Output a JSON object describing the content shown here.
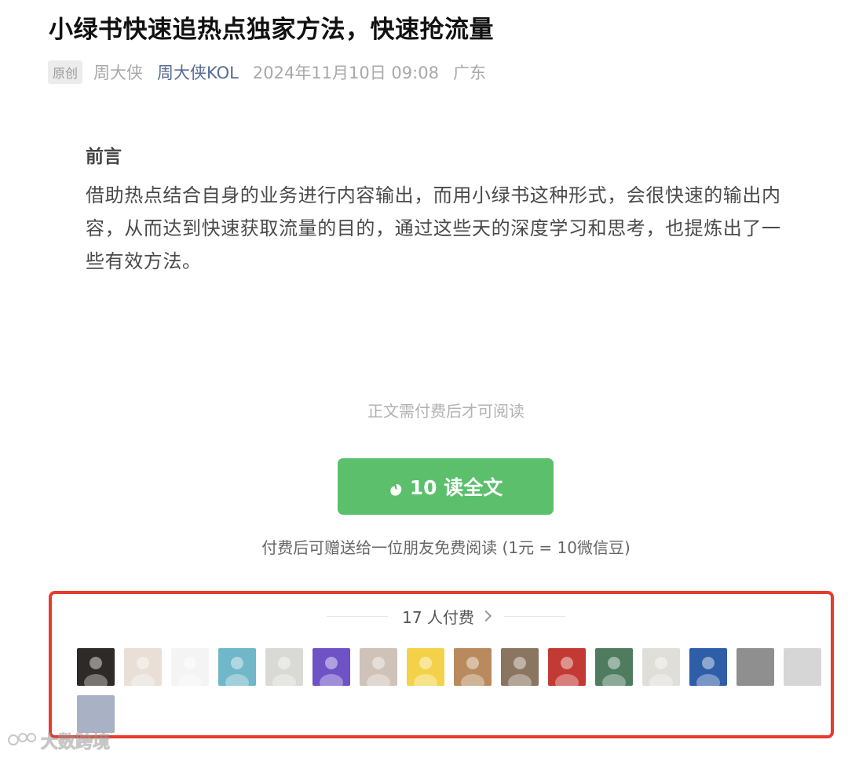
{
  "article": {
    "title": "小绿书快速追热点独家方法，快速抢流量",
    "badge": "原创",
    "author": "周大侠",
    "account": "周大侠KOL",
    "date": "2024年11月10日 09:08",
    "location": "广东"
  },
  "content": {
    "heading": "前言",
    "body": "借助热点结合自身的业务进行内容输出，而用小绿书这种形式，会很快速的输出内容，从而达到快速获取流量的目的，通过这些天的深度学习和思考，也提炼出了一些有效方法。"
  },
  "paywall": {
    "note": "正文需付费后才可阅读",
    "button_label": "10 读全文",
    "gift_note": "付费后可赠送给一位朋友免费阅读 (1元 = 10微信豆)",
    "payers_label": "17 人付费",
    "accent_color": "#5bbf6c",
    "highlight_color": "#e63b2e"
  },
  "avatars": [
    {
      "name": "payer-1",
      "color": "#2e2a28"
    },
    {
      "name": "payer-2",
      "color": "#e9dfd6"
    },
    {
      "name": "payer-3",
      "color": "#f4f4f4"
    },
    {
      "name": "payer-4",
      "color": "#6fb7c9"
    },
    {
      "name": "payer-5",
      "color": "#d9d9d6"
    },
    {
      "name": "payer-6",
      "color": "#6e52c6"
    },
    {
      "name": "payer-7",
      "color": "#cfc2b8"
    },
    {
      "name": "payer-8",
      "color": "#f3d24a"
    },
    {
      "name": "payer-9",
      "color": "#b88a5e"
    },
    {
      "name": "payer-10",
      "color": "#8a7560"
    },
    {
      "name": "payer-11",
      "color": "#c23a33"
    },
    {
      "name": "payer-12",
      "color": "#4f7b5f"
    },
    {
      "name": "payer-13",
      "color": "#e0ded9"
    },
    {
      "name": "payer-14",
      "color": "#2f5ea8"
    },
    {
      "name": "payer-15",
      "color": "#8f8f8f"
    },
    {
      "name": "payer-16",
      "color": "#d6d6d6"
    },
    {
      "name": "payer-17",
      "color": "#a9b1c4"
    }
  ],
  "watermark": {
    "text": "大数跨境"
  }
}
